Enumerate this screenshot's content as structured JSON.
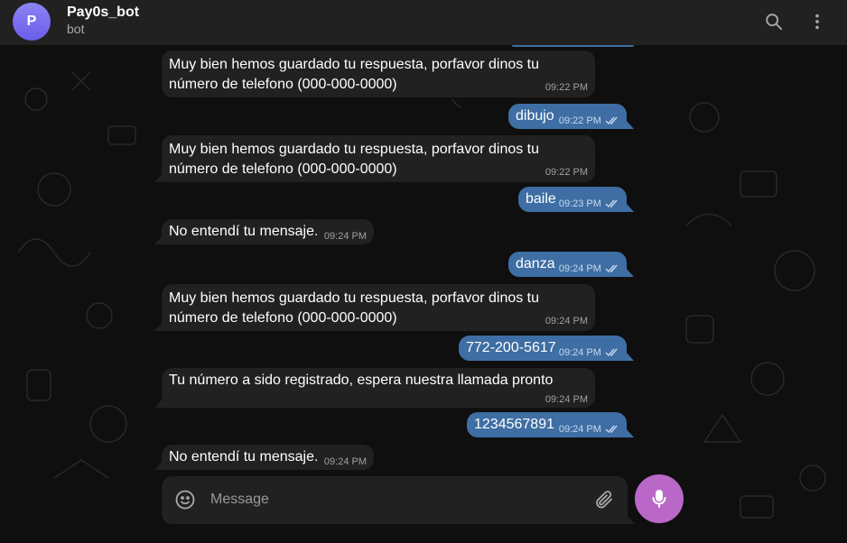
{
  "header": {
    "avatar_letter": "P",
    "title": "Pay0s_bot",
    "subtitle": "bot"
  },
  "messages": [
    {
      "dir": "in",
      "text": "Muy bien hemos guardado tu respuesta, porfavor dinos tu número de telefono (000-000-0000)",
      "time": "09:22 PM"
    },
    {
      "dir": "out",
      "text": "dibujo",
      "time": "09:22 PM"
    },
    {
      "dir": "in",
      "text": "Muy bien hemos guardado tu respuesta, porfavor dinos tu número de telefono (000-000-0000)",
      "time": "09:22 PM"
    },
    {
      "dir": "out",
      "text": "baile",
      "time": "09:23 PM"
    },
    {
      "dir": "in",
      "text": "No entendí tu mensaje.",
      "time": "09:24 PM"
    },
    {
      "dir": "out",
      "text": "danza",
      "time": "09:24 PM"
    },
    {
      "dir": "in",
      "text": "Muy bien hemos guardado tu respuesta, porfavor dinos tu número de telefono (000-000-0000)",
      "time": "09:24 PM"
    },
    {
      "dir": "out",
      "text": "772-200-5617",
      "time": "09:24 PM"
    },
    {
      "dir": "in",
      "text": "Tu número a sido registrado, espera nuestra llamada pronto",
      "time": "09:24 PM"
    },
    {
      "dir": "out",
      "text": "1234567891",
      "time": "09:24 PM"
    },
    {
      "dir": "in",
      "text": "No entendí tu mensaje.",
      "time": "09:24 PM"
    }
  ],
  "composer": {
    "placeholder": "Message"
  },
  "icons": {
    "header": [
      "search-icon",
      "more-vertical-icon"
    ],
    "composer": [
      "emoji-icon",
      "paperclip-icon",
      "microphone-icon"
    ],
    "status": "double-check-icon"
  },
  "colors": {
    "header_bg": "#212121",
    "incoming_bubble": "#212121",
    "outgoing_bubble": "#3e6ea3",
    "mic_button": "#ba68c8",
    "avatar": "#7b6ff0"
  }
}
